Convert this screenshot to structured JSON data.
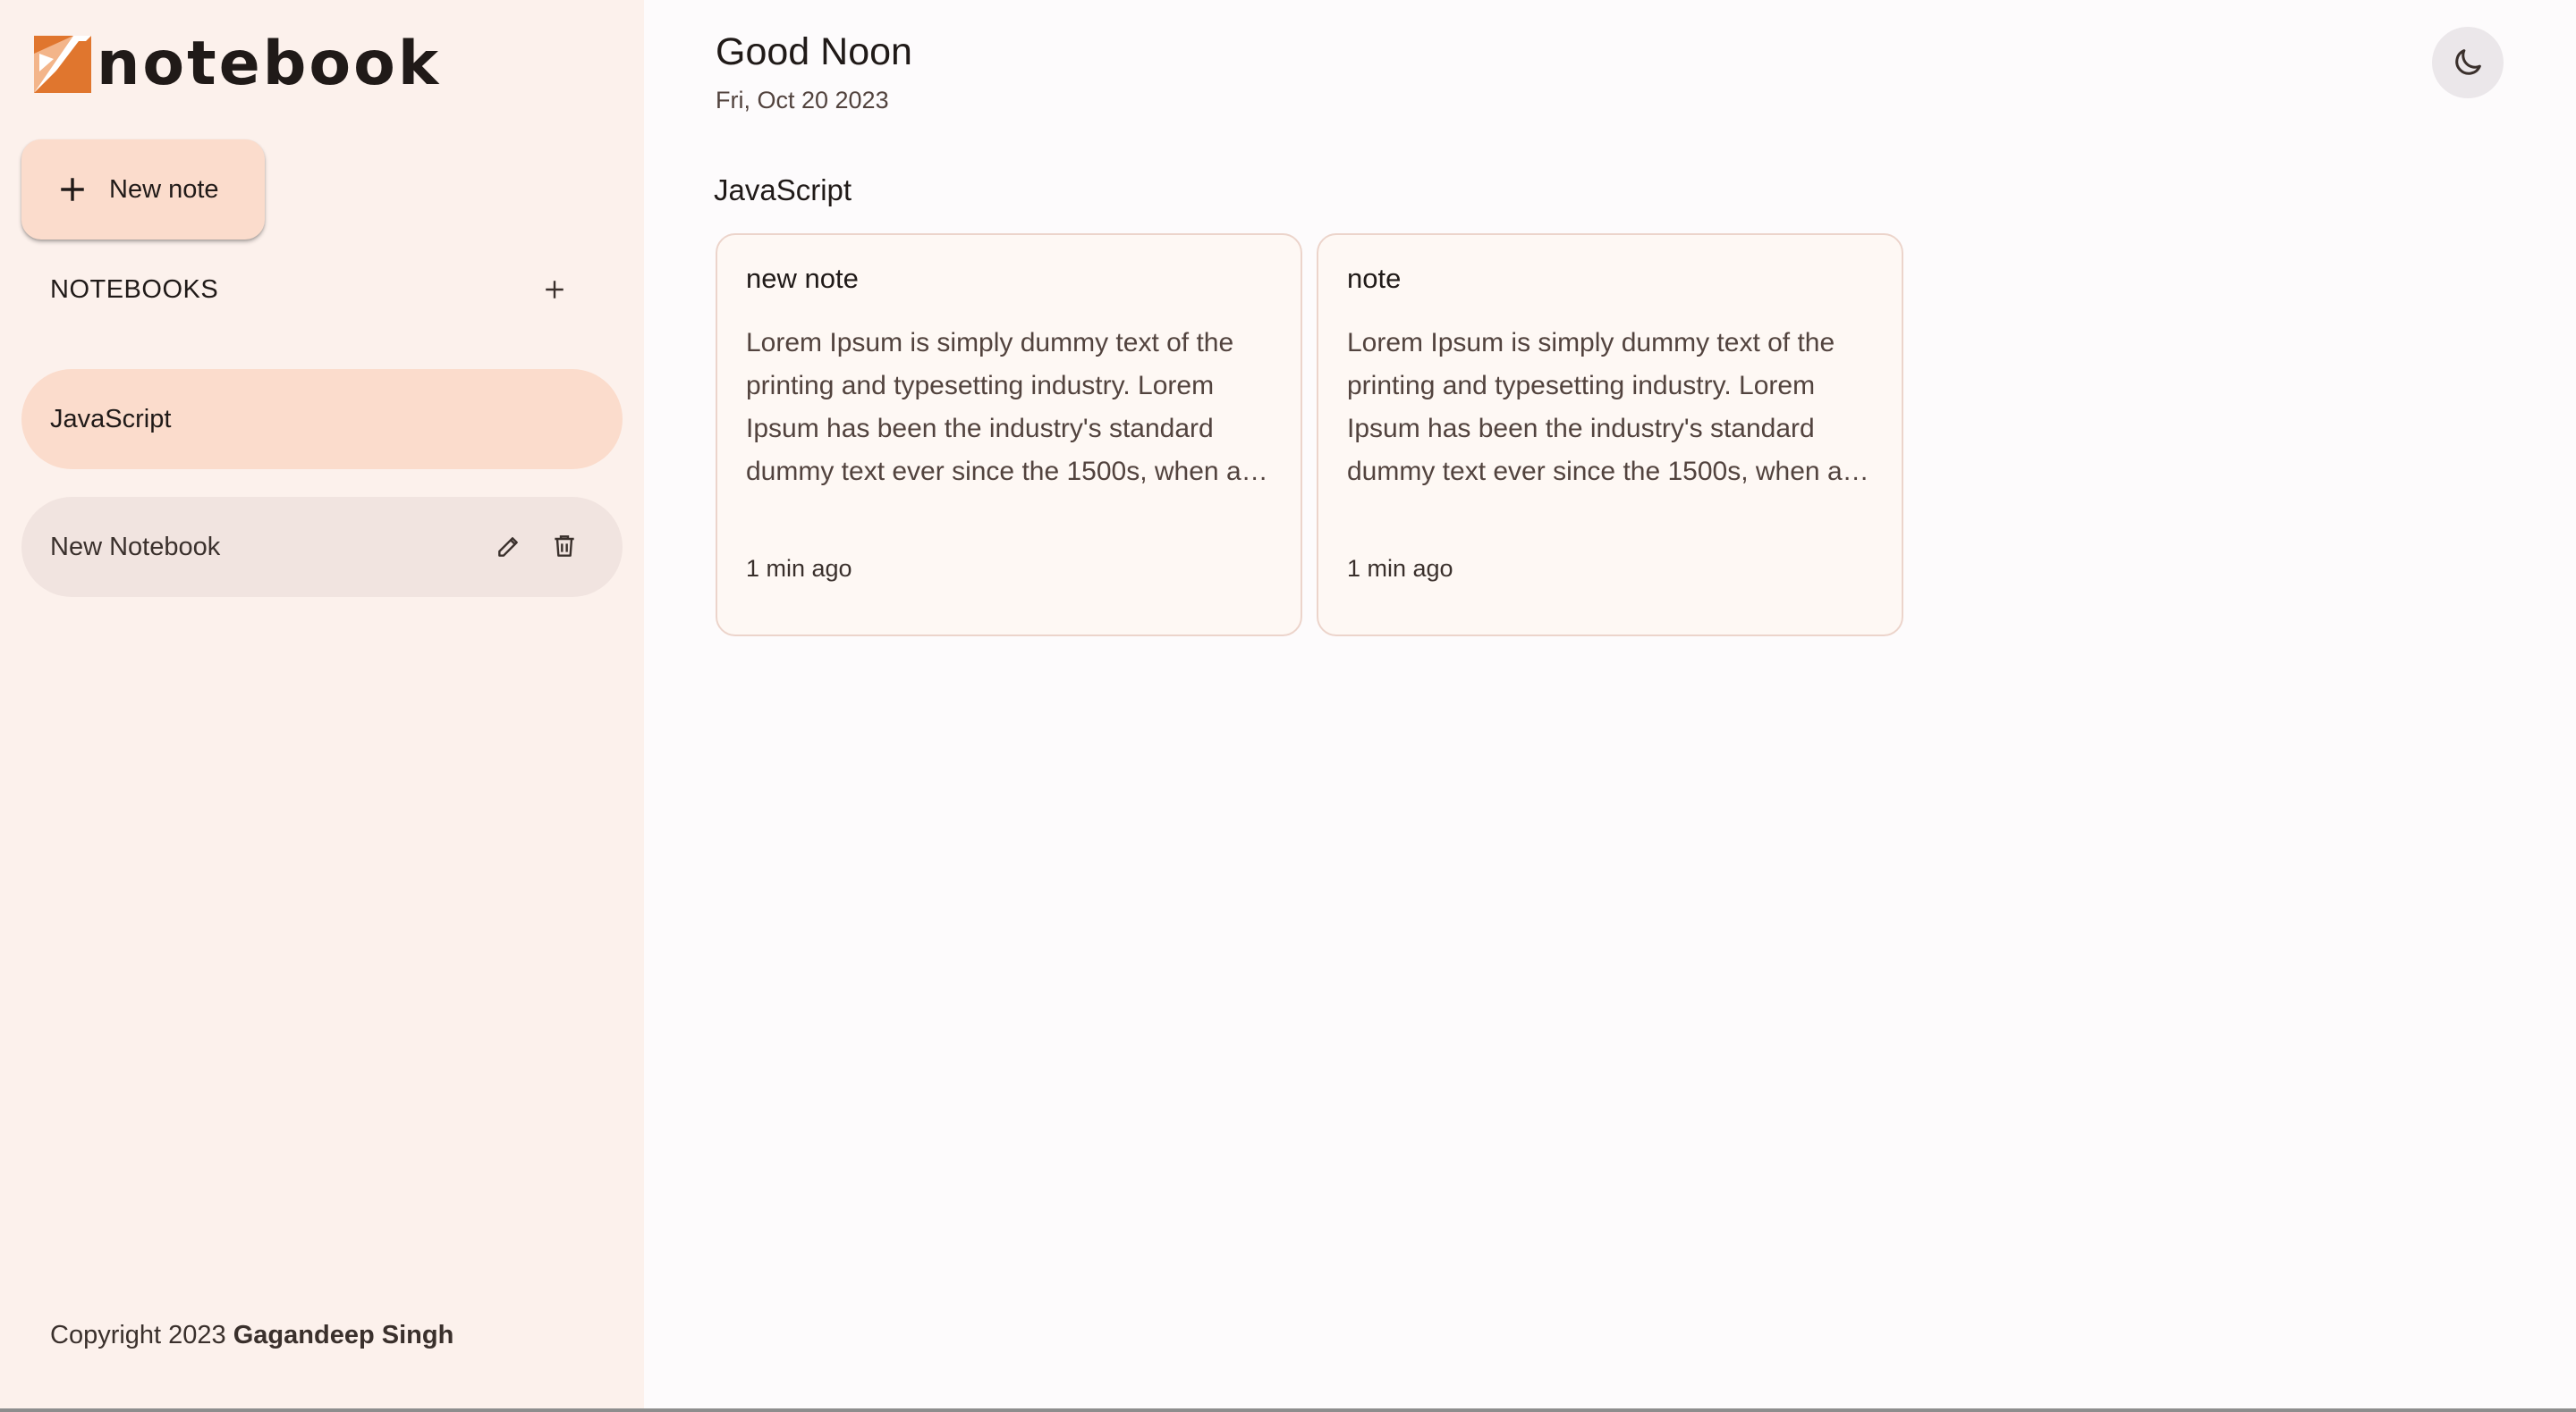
{
  "app": {
    "name": "notebook"
  },
  "sidebar": {
    "new_note_label": "New note",
    "notebooks_title": "NOTEBOOKS",
    "notebooks": [
      {
        "label": "JavaScript",
        "active": true
      },
      {
        "label": "New Notebook",
        "active": false
      }
    ],
    "copyright_prefix": "Copyright 2023",
    "copyright_author": "Gagandeep Singh"
  },
  "header": {
    "greeting": "Good Noon",
    "date": "Fri, Oct 20 2023"
  },
  "main": {
    "section_title": "JavaScript",
    "notes": [
      {
        "title": "new note",
        "body": "Lorem Ipsum is simply dummy text of the printing and typesetting industry. Lorem Ipsum has been the industry's standard dummy text ever since the 1500s, when an unknown printer took a galley of type and scrambled it to make a type specimen book.",
        "time": "1 min ago"
      },
      {
        "title": "note",
        "body": "Lorem Ipsum is simply dummy text of the printing and typesetting industry. Lorem Ipsum has been the industry's standard dummy text ever since the 1500s, when an unknown printer took a galley of type and scrambled it to make a type specimen book.",
        "time": "1 min ago"
      }
    ]
  },
  "icons": {
    "logo": "notebook-logo-icon",
    "new_note": "plus-icon",
    "add_notebook": "plus-icon",
    "edit": "pencil-icon",
    "delete": "trash-icon",
    "theme": "moon-icon"
  },
  "colors": {
    "accent": "#e0762e",
    "sidebar_bg": "#fcf1ec",
    "active_item": "#fbdccc",
    "hover_item": "#f1e4e0",
    "card_bg": "#fef8f4",
    "card_border": "#ecd4cb"
  }
}
